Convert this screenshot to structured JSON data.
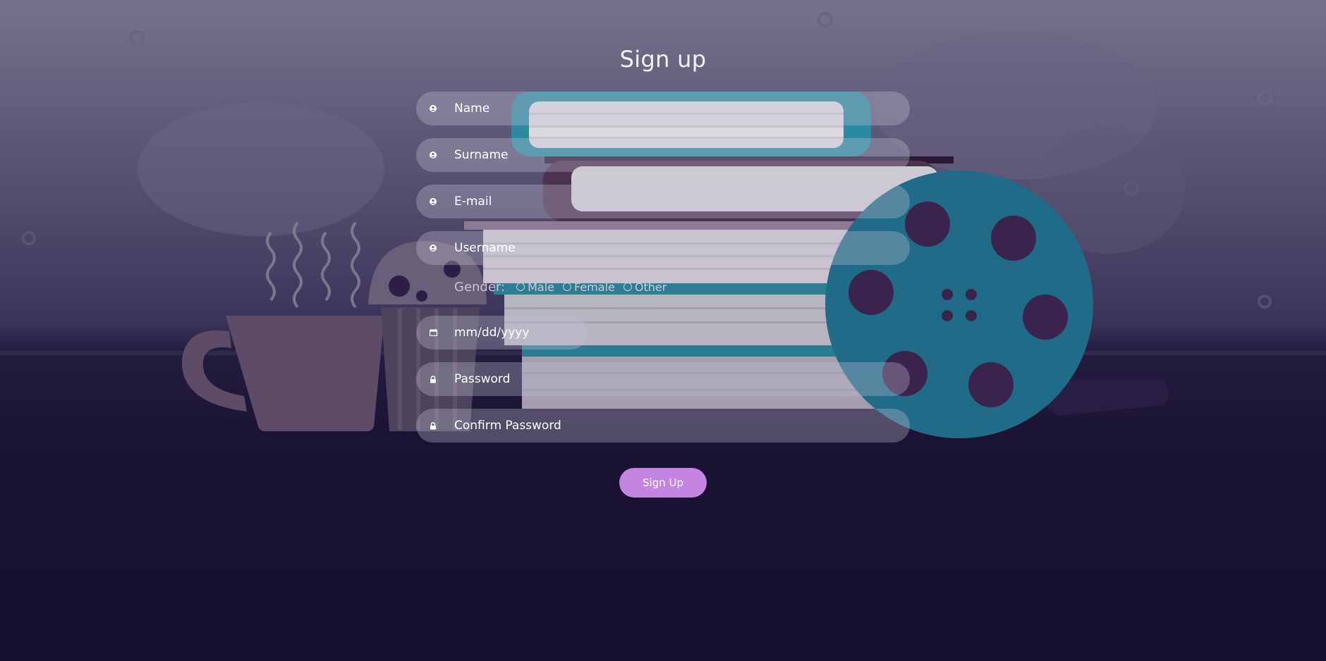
{
  "page": {
    "title": "Sign up"
  },
  "form": {
    "name": {
      "placeholder": "Name",
      "value": "",
      "icon": "user-icon"
    },
    "surname": {
      "placeholder": "Surname",
      "value": "",
      "icon": "user-icon"
    },
    "email": {
      "placeholder": "E-mail",
      "value": "",
      "icon": "user-icon"
    },
    "username": {
      "placeholder": "Username",
      "value": "",
      "icon": "user-icon"
    },
    "gender": {
      "label": "Gender:",
      "options": [
        "Male",
        "Female",
        "Other"
      ],
      "selected": ""
    },
    "birthdate": {
      "placeholder": "mm/dd/yyyy",
      "value": "",
      "icon": "calendar-icon"
    },
    "password": {
      "placeholder": "Password",
      "value": "",
      "icon": "lock-icon"
    },
    "confirm_password": {
      "placeholder": "Confirm Password",
      "value": "",
      "icon": "lock-icon"
    },
    "submit_label": "Sign Up"
  },
  "colors": {
    "accent": "#c485e2",
    "background_top": "#77718c",
    "background_bottom": "#160f2e",
    "reel": "#1f6b88"
  }
}
